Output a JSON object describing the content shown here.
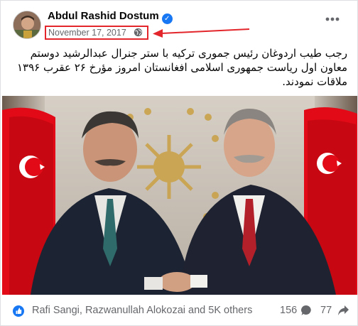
{
  "post": {
    "author": "Abdul Rashid Dostum",
    "date": "November 17, 2017",
    "text": "رجب طیب اردوغان رئیس جموری ترکیه با ستر جنرال عبدالرشید دوستم معاون اول ریاست جمهوری اسلامی افغانستان امروز مؤرخ ۲۶ عقرب ۱۳۹۶ ملاقات نمودند."
  },
  "footer": {
    "reactions_text": "Rafi Sangi, Razwanullah Alokozai and 5K others",
    "comments_count": "156",
    "shares_count": "77"
  },
  "icons": {
    "verified": "verified-badge-icon",
    "privacy": "globe-icon",
    "more": "more-options-icon",
    "comment": "comment-icon",
    "share": "share-icon",
    "reactions": [
      "like-icon",
      "love-icon"
    ]
  },
  "colors": {
    "annotation_red": "#e3262b",
    "brand_blue": "#1877f2",
    "secondary_text": "#65676b",
    "flag_red": "#e30a17"
  }
}
